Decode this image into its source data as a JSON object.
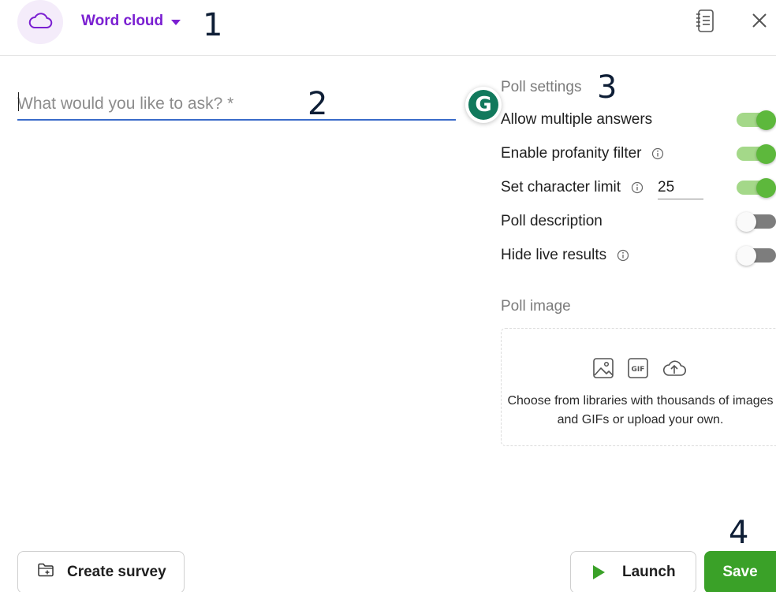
{
  "header": {
    "poll_type": "Word cloud",
    "icons": {
      "type": "cloud-icon",
      "caret": "chevron-down-icon",
      "notes": "notes-icon",
      "close": "close-icon"
    }
  },
  "annotations": [
    "1",
    "2",
    "3",
    "4"
  ],
  "question": {
    "placeholder": "What would you like to ask? *",
    "value": ""
  },
  "grammarly": {
    "icon": "grammarly-icon",
    "letter": "G"
  },
  "settings": {
    "title": "Poll settings",
    "items": [
      {
        "label": "Allow multiple answers",
        "info": false,
        "enabled": true
      },
      {
        "label": "Enable profanity filter",
        "info": true,
        "enabled": true
      },
      {
        "label": "Set character limit",
        "info": true,
        "enabled": true,
        "limit": "25"
      },
      {
        "label": "Poll description",
        "info": false,
        "enabled": false
      },
      {
        "label": "Hide live results",
        "info": true,
        "enabled": false
      }
    ]
  },
  "poll_image": {
    "title": "Poll image",
    "description": "Choose from libraries with thousands of images and GIFs or upload your own.",
    "gif_label": "GIF",
    "icons": [
      "image-icon",
      "gif-icon",
      "cloud-upload-icon"
    ]
  },
  "footer": {
    "create_survey": "Create survey",
    "launch": "Launch",
    "save": "Save"
  },
  "colors": {
    "accent": "#7a1fd1",
    "primary_green": "#3aa128",
    "toggle_on": "#5db83c",
    "underline": "#3a6bc9"
  }
}
